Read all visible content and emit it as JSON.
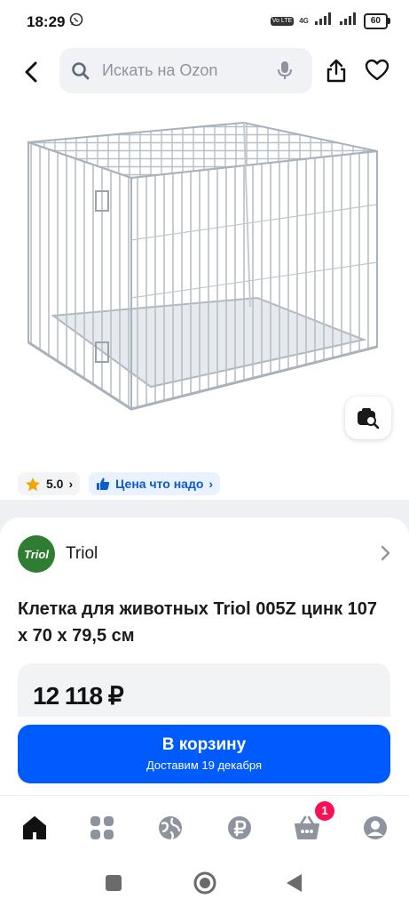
{
  "status": {
    "time": "18:29",
    "network_badge": "Vo LTE",
    "network_type": "4G",
    "battery": "60"
  },
  "header": {
    "search_placeholder": "Искать на Ozon",
    "icons": [
      "back-arrow-icon",
      "search-icon",
      "mic-icon",
      "share-icon",
      "heart-icon"
    ]
  },
  "badges": {
    "rating": "5.0",
    "price_tag": "Цена что надо"
  },
  "seller": {
    "logo_text": "Triol",
    "name": "Triol"
  },
  "product": {
    "title": "Клетка для животных Triol 005Z цинк 107 x 70 x 79,5 см",
    "price": "12 118 ₽"
  },
  "cart": {
    "label": "В корзину",
    "delivery": "Доставим 19 декабря",
    "count": "1"
  },
  "colors": {
    "accent": "#005bff",
    "badge": "#f91155",
    "brand_logo": "#2e7d32"
  },
  "bottom_nav": [
    "home-icon",
    "catalog-icon",
    "fresh-icon",
    "finance-icon",
    "cart-icon",
    "profile-icon"
  ]
}
